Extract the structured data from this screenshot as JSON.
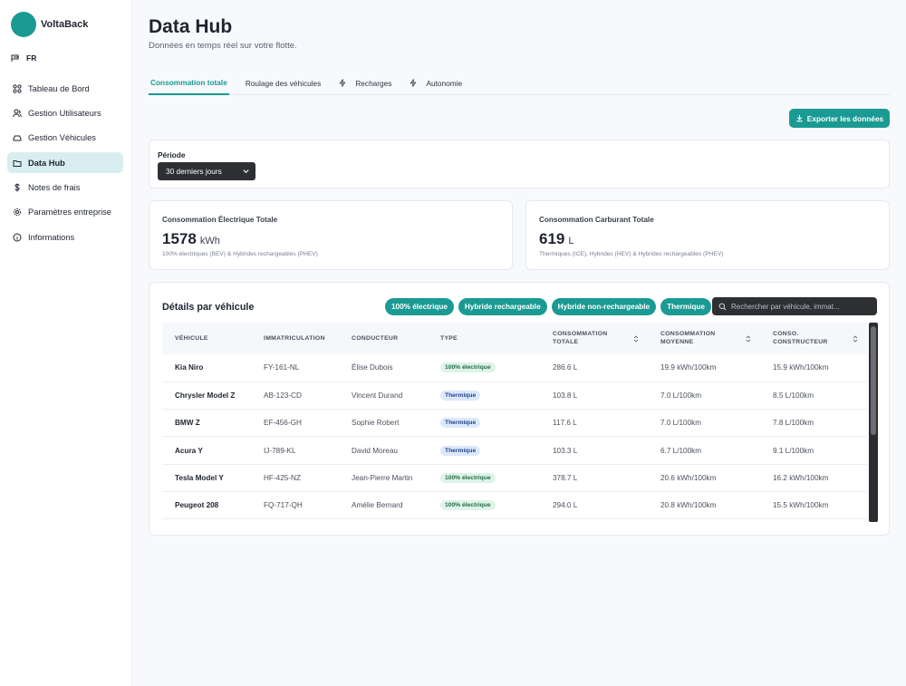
{
  "brand": {
    "name": "VoltaBack",
    "color": "#1a9a93"
  },
  "language": "FR",
  "sidebar": {
    "items": [
      {
        "label": "Tableau de Bord",
        "icon": "grid-icon",
        "active": false
      },
      {
        "label": "Gestion Utilisateurs",
        "icon": "users-icon",
        "active": false
      },
      {
        "label": "Gestion Véhicules",
        "icon": "car-icon",
        "active": false
      },
      {
        "label": "Data Hub",
        "icon": "folder-icon",
        "active": true
      },
      {
        "label": "Notes de frais",
        "icon": "dollar-icon",
        "active": false
      },
      {
        "label": "Paramètres entreprise",
        "icon": "gear-icon",
        "active": false
      },
      {
        "label": "Informations",
        "icon": "info-icon",
        "active": false
      }
    ]
  },
  "header": {
    "title": "Data Hub",
    "subtitle": "Données en temps réel sur votre flotte."
  },
  "tabs": [
    {
      "label": "Consommation totale",
      "icon": "",
      "active": true
    },
    {
      "label": "Roulage des véhicules",
      "icon": "",
      "active": false
    },
    {
      "label": "Recharges",
      "icon": "bolt-icon",
      "active": false
    },
    {
      "label": "Autonomie",
      "icon": "bolt-icon",
      "active": false
    }
  ],
  "export_button": {
    "label": "Exporter les données",
    "icon": "download-icon"
  },
  "period": {
    "label": "Période",
    "value": "30 derniers jours"
  },
  "stats": {
    "electric": {
      "title": "Consommation Électrique Totale",
      "value": "1578",
      "unit": "kWh",
      "note": "100% électriques (BEV) & Hybrides rechargeables (PHEV)"
    },
    "fuel": {
      "title": "Consommation Carburant Totale",
      "value": "619",
      "unit": "L",
      "note": "Thermiques (ICE), Hybrides (HEV) & Hybrides rechargeables (PHEV)"
    }
  },
  "details": {
    "title": "Détails par véhicule",
    "filters": [
      "100% électrique",
      "Hybride rechargeable",
      "Hybride non-rechargeable",
      "Thermique"
    ],
    "search_placeholder": "Rechercher par véhicule, immat...",
    "columns": [
      "VÉHICULE",
      "IMMATRICULATION",
      "CONDUCTEUR",
      "TYPE",
      "CONSOMMATION TOTALE",
      "CONSOMMATION MOYENNE",
      "CONSO. CONSTRUCTEUR"
    ],
    "rows": [
      {
        "vehicle": "Kia Niro",
        "plate": "FY-161-NL",
        "driver": "Élise Dubois",
        "type": "100% électrique",
        "kind": "ev",
        "total": "286.6 L",
        "avg": "19.9 kWh/100km",
        "maker": "15.9 kWh/100km"
      },
      {
        "vehicle": "Chrysler Model Z",
        "plate": "AB-123-CD",
        "driver": "Vincent Durand",
        "type": "Thermique",
        "kind": "th",
        "total": "103.8 L",
        "avg": "7.0 L/100km",
        "maker": "8.5 L/100km"
      },
      {
        "vehicle": "BMW Z",
        "plate": "EF-456-GH",
        "driver": "Sophie Robert",
        "type": "Thermique",
        "kind": "th",
        "total": "117.6 L",
        "avg": "7.0 L/100km",
        "maker": "7.8 L/100km"
      },
      {
        "vehicle": "Acura Y",
        "plate": "IJ-789-KL",
        "driver": "David Moreau",
        "type": "Thermique",
        "kind": "th",
        "total": "103.3 L",
        "avg": "6.7 L/100km",
        "maker": "9.1 L/100km"
      },
      {
        "vehicle": "Tesla Model Y",
        "plate": "HF-425-NZ",
        "driver": "Jean-Pierre Martin",
        "type": "100% électrique",
        "kind": "ev",
        "total": "378.7 L",
        "avg": "20.6 kWh/100km",
        "maker": "16.2 kWh/100km"
      },
      {
        "vehicle": "Peugeot 208",
        "plate": "FQ-717-QH",
        "driver": "Amélie Bernard",
        "type": "100% électrique",
        "kind": "ev",
        "total": "294.0 L",
        "avg": "20.8 kWh/100km",
        "maker": "15.5 kWh/100km"
      }
    ]
  }
}
